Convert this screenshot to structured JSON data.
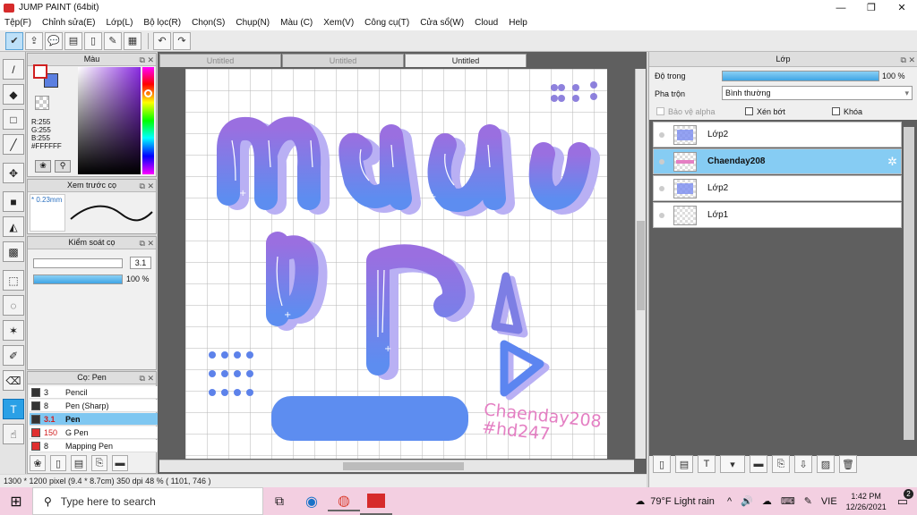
{
  "window": {
    "title": "JUMP PAINT (64bit)",
    "minimize": "—",
    "maximize": "❐",
    "close": "✕"
  },
  "menu": [
    "Tệp(F)",
    "Chỉnh sửa(E)",
    "Lớp(L)",
    "Bộ lọc(R)",
    "Chọn(S)",
    "Chụp(N)",
    "Màu (C)",
    "Xem(V)",
    "Công cụ(T)",
    "Cửa sổ(W)",
    "Cloud",
    "Help"
  ],
  "toolbar_icons": [
    "check-icon",
    "share-icon",
    "comment-icon",
    "message-icon",
    "page-icon",
    "edit-page-icon",
    "grid-icon",
    "undo-icon",
    "redo-icon"
  ],
  "tool_icons": [
    "brush-icon",
    "eraser-icon",
    "rectangle-icon",
    "fill-brush-icon",
    "move-icon",
    "fill-rect-icon",
    "bucket-icon",
    "gradient-icon",
    "select-rect-icon",
    "lasso-icon",
    "magic-wand-icon",
    "select-pen-icon",
    "select-eraser-icon",
    "text-icon",
    "hand-icon"
  ],
  "color_panel": {
    "title": "Màu",
    "r": "R:255",
    "g": "G:255",
    "b": "B:255",
    "hex": "#FFFFFF",
    "fg": "#ffffff",
    "bg": "#4f78e8"
  },
  "brush_preview": {
    "title": "Xem trước cọ",
    "size": "* 0.23mm"
  },
  "brush_control": {
    "title": "Kiểm soát cọ",
    "size_value": "3.1",
    "opacity_value": "100 %",
    "opacity": 1.0
  },
  "brush_list": {
    "title": "Cọ: Pen",
    "items": [
      {
        "size": "3",
        "name": "Pencil",
        "color": "#333333"
      },
      {
        "size": "8",
        "name": "Pen (Sharp)",
        "color": "#333333"
      },
      {
        "size": "3.1",
        "name": "Pen",
        "color": "#333333",
        "selected": true
      },
      {
        "size": "150",
        "name": "G Pen",
        "color": "#e03030"
      },
      {
        "size": "8",
        "name": "Mapping Pen",
        "color": "#e03030"
      }
    ]
  },
  "tabs": [
    {
      "label": "Untitled"
    },
    {
      "label": "Untitled"
    },
    {
      "label": "Untitled",
      "active": true
    }
  ],
  "canvas": {
    "watermark_1": "Chaenday208",
    "watermark_2": "#hd247"
  },
  "status": "1300 * 1200 pixel  (9.4 * 8.7cm)  350 dpi   48 %   ( 1101, 746 )",
  "layer_panel": {
    "title": "Lớp",
    "opacity_label": "Độ trong",
    "opacity_value": "100 %",
    "opacity": 1.0,
    "blend_label": "Pha trộn",
    "blend_value": "Bình thường",
    "protect_alpha": "Bảo vệ alpha",
    "clip": "Xén bớt",
    "lock": "Khóa",
    "layers": [
      {
        "name": "Lớp2"
      },
      {
        "name": "Chaenday208",
        "selected": true
      },
      {
        "name": "Lớp2"
      },
      {
        "name": "Lớp1"
      }
    ]
  },
  "taskbar": {
    "search_placeholder": "Type here to search",
    "weather": "79°F  Light rain",
    "lang": "VIE",
    "time": "1:42 PM",
    "date": "12/26/2021",
    "notif_count": "2"
  }
}
